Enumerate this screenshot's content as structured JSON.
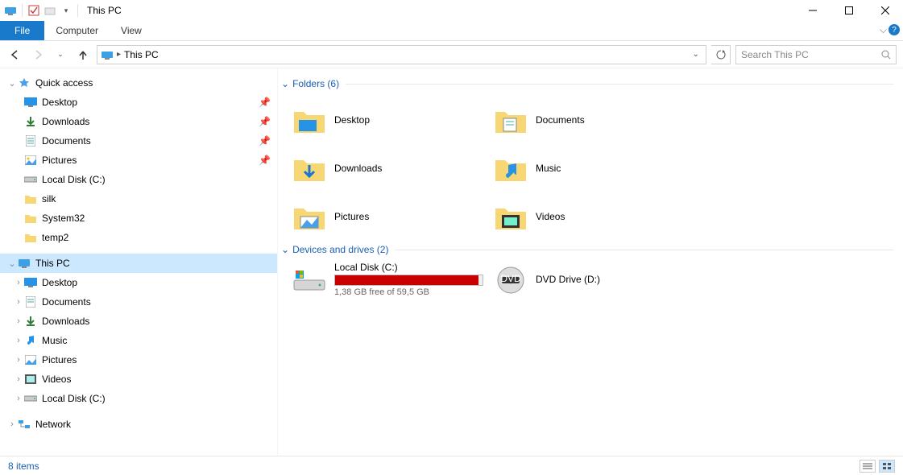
{
  "titlebar": {
    "title": "This PC"
  },
  "ribbon": {
    "tabs": {
      "file": "File",
      "computer": "Computer",
      "view": "View"
    }
  },
  "address": {
    "location": "This PC",
    "search_placeholder": "Search This PC"
  },
  "sidebar": {
    "quick_access": {
      "label": "Quick access",
      "items": [
        {
          "label": "Desktop",
          "pinned": true
        },
        {
          "label": "Downloads",
          "pinned": true
        },
        {
          "label": "Documents",
          "pinned": true
        },
        {
          "label": "Pictures",
          "pinned": true
        },
        {
          "label": "Local Disk (C:)",
          "pinned": false
        },
        {
          "label": "silk",
          "pinned": false
        },
        {
          "label": "System32",
          "pinned": false
        },
        {
          "label": "temp2",
          "pinned": false
        }
      ]
    },
    "this_pc": {
      "label": "This PC",
      "items": [
        {
          "label": "Desktop"
        },
        {
          "label": "Documents"
        },
        {
          "label": "Downloads"
        },
        {
          "label": "Music"
        },
        {
          "label": "Pictures"
        },
        {
          "label": "Videos"
        },
        {
          "label": "Local Disk (C:)"
        }
      ]
    },
    "network": {
      "label": "Network"
    }
  },
  "content": {
    "folders": {
      "header": "Folders (6)",
      "items": [
        {
          "label": "Desktop"
        },
        {
          "label": "Documents"
        },
        {
          "label": "Downloads"
        },
        {
          "label": "Music"
        },
        {
          "label": "Pictures"
        },
        {
          "label": "Videos"
        }
      ]
    },
    "drives": {
      "header": "Devices and drives (2)",
      "local_disk": {
        "label": "Local Disk (C:)",
        "subtext": "1,38 GB free of 59,5 GB",
        "fill_percent": 97
      },
      "dvd": {
        "label": "DVD Drive (D:)"
      }
    }
  },
  "status": {
    "text": "8 items"
  }
}
